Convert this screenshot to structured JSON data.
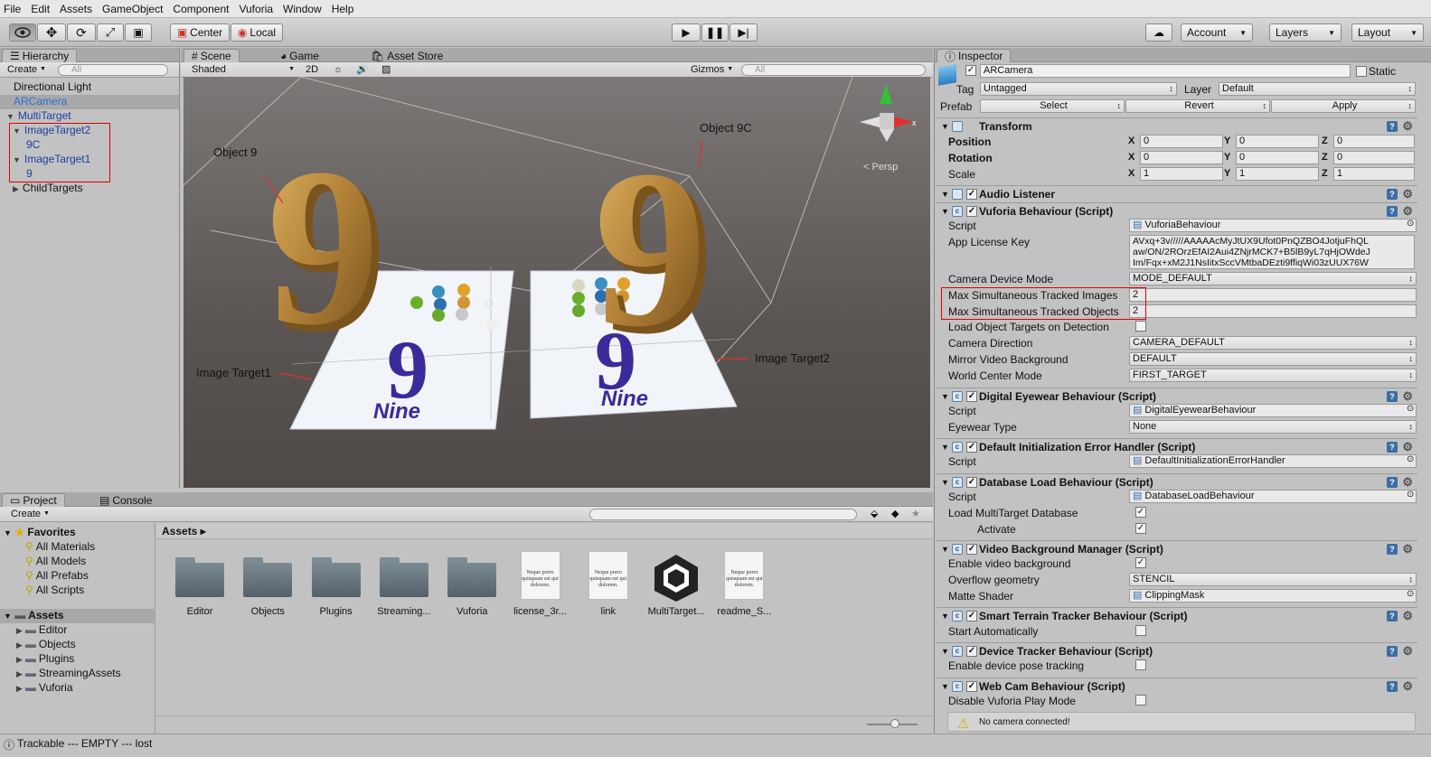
{
  "menu": [
    "File",
    "Edit",
    "Assets",
    "GameObject",
    "Component",
    "Vuforia",
    "Window",
    "Help"
  ],
  "toolbar": {
    "center": "Center",
    "local": "Local",
    "account": "Account",
    "layers": "Layers",
    "layout": "Layout"
  },
  "hierarchy": {
    "tab": "Hierarchy",
    "create": "Create",
    "search": "All",
    "items": [
      {
        "label": "Directional Light",
        "indent": 1,
        "arrow": "",
        "color": "#111",
        "selected": false
      },
      {
        "label": "ARCamera",
        "indent": 1,
        "arrow": "",
        "color": "#2a6fcf",
        "selected": true
      },
      {
        "label": "MultiTarget",
        "indent": 1,
        "arrow": "▼",
        "color": "#1a3fa0",
        "selected": false
      },
      {
        "label": "ImageTarget2",
        "indent": 2,
        "arrow": "▼",
        "color": "#1a3fa0",
        "selected": false
      },
      {
        "label": "9C",
        "indent": 3,
        "arrow": "",
        "color": "#1a3fa0",
        "selected": false
      },
      {
        "label": "ImageTarget1",
        "indent": 2,
        "arrow": "▼",
        "color": "#1a3fa0",
        "selected": false
      },
      {
        "label": "9",
        "indent": 3,
        "arrow": "",
        "color": "#1a3fa0",
        "selected": false
      },
      {
        "label": "ChildTargets",
        "indent": 2,
        "arrow": "▶",
        "color": "#111",
        "selected": false
      }
    ]
  },
  "scene": {
    "tabs": [
      "Scene",
      "Game",
      "Asset Store"
    ],
    "shaded": "Shaded",
    "mode2d": "2D",
    "gizmos": "Gizmos",
    "search": "All",
    "persp": "< Persp",
    "annotations": {
      "obj9": "Object 9",
      "obj9c": "Object 9C",
      "it1": "Image Target1",
      "it2": "Image Target2"
    },
    "digit": "9",
    "word": "Nine"
  },
  "project": {
    "tabs": [
      "Project",
      "Console"
    ],
    "create": "Create",
    "favorites_label": "Favorites",
    "favorites": [
      "All Materials",
      "All Models",
      "All Prefabs",
      "All Scripts"
    ],
    "assets_label": "Assets",
    "asset_folders": [
      "Editor",
      "Objects",
      "Plugins",
      "StreamingAssets",
      "Vuforia"
    ],
    "breadcrumb": "Assets ▸",
    "grid": [
      {
        "label": "Editor",
        "kind": "folder"
      },
      {
        "label": "Objects",
        "kind": "folder"
      },
      {
        "label": "Plugins",
        "kind": "folder"
      },
      {
        "label": "Streaming...",
        "kind": "folder"
      },
      {
        "label": "Vuforia",
        "kind": "folder"
      },
      {
        "label": "license_3r...",
        "kind": "doc"
      },
      {
        "label": "link",
        "kind": "doc"
      },
      {
        "label": "MultiTarget...",
        "kind": "unity"
      },
      {
        "label": "readme_S...",
        "kind": "doc"
      }
    ],
    "doc_text": "Neque porro quisquam est qui dolorem."
  },
  "inspector": {
    "tab": "Inspector",
    "name": "ARCamera",
    "static": "Static",
    "tag_label": "Tag",
    "tag": "Untagged",
    "layer_label": "Layer",
    "layer": "Default",
    "prefab_label": "Prefab",
    "prefab_buttons": [
      "Select",
      "Revert",
      "Apply"
    ],
    "transform": {
      "title": "Transform",
      "rows": [
        {
          "label": "Position",
          "x": "0",
          "y": "0",
          "z": "0",
          "bold": true
        },
        {
          "label": "Rotation",
          "x": "0",
          "y": "0",
          "z": "0",
          "bold": true
        },
        {
          "label": "Scale",
          "x": "1",
          "y": "1",
          "z": "1",
          "bold": false
        }
      ]
    },
    "audio": "Audio Listener",
    "vuforia": {
      "title": "Vuforia Behaviour (Script)",
      "script_label": "Script",
      "script": "VuforiaBehaviour",
      "license_label": "App License Key",
      "license": [
        "AVxq+3v/////AAAAAcMyJtUX9Ufot0PnQZBO4JotjuFhQL",
        "aw/ON/2ROrzEfAI2Aui4ZNjrMCK7+B5lB9yL7qHjOWdeJ",
        "Im/Fqx+xM2J1NsIitxSccVMtbaDEzti9ffiqWi03zUUX76W"
      ],
      "rows": [
        {
          "label": "Camera Device Mode",
          "value": "MODE_DEFAULT",
          "type": "drop"
        },
        {
          "label": "Max Simultaneous Tracked Images",
          "value": "2",
          "type": "text"
        },
        {
          "label": "Max Simultaneous Tracked Objects",
          "value": "2",
          "type": "text"
        },
        {
          "label": "Load Object Targets on Detection",
          "value": "",
          "type": "check"
        },
        {
          "label": "Camera Direction",
          "value": "CAMERA_DEFAULT",
          "type": "drop"
        },
        {
          "label": "Mirror Video Background",
          "value": "DEFAULT",
          "type": "drop"
        },
        {
          "label": "World Center Mode",
          "value": "FIRST_TARGET",
          "type": "drop"
        }
      ]
    },
    "eyewear": {
      "title": "Digital Eyewear Behaviour (Script)",
      "script": "DigitalEyewearBehaviour",
      "type_label": "Eyewear Type",
      "type": "None"
    },
    "errhandler": {
      "title": "Default Initialization Error Handler (Script)",
      "script": "DefaultInitializationErrorHandler"
    },
    "dbload": {
      "title": "Database Load Behaviour (Script)",
      "script": "DatabaseLoadBehaviour",
      "load_label": "Load MultiTarget Database",
      "activate_label": "Activate"
    },
    "videobg": {
      "title": "Video Background Manager (Script)",
      "enable_label": "Enable video background",
      "overflow_label": "Overflow geometry",
      "overflow": "STENCIL",
      "matte_label": "Matte Shader",
      "matte": "ClippingMask"
    },
    "terrain": {
      "title": "Smart Terrain Tracker Behaviour (Script)",
      "start_label": "Start Automatically"
    },
    "devtracker": {
      "title": "Device Tracker Behaviour (Script)",
      "pose_label": "Enable device pose tracking"
    },
    "webcam": {
      "title": "Web Cam Behaviour (Script)",
      "disable_label": "Disable Vuforia Play Mode",
      "warning": "No camera connected!"
    }
  },
  "status": "Trackable --- EMPTY --- lost"
}
